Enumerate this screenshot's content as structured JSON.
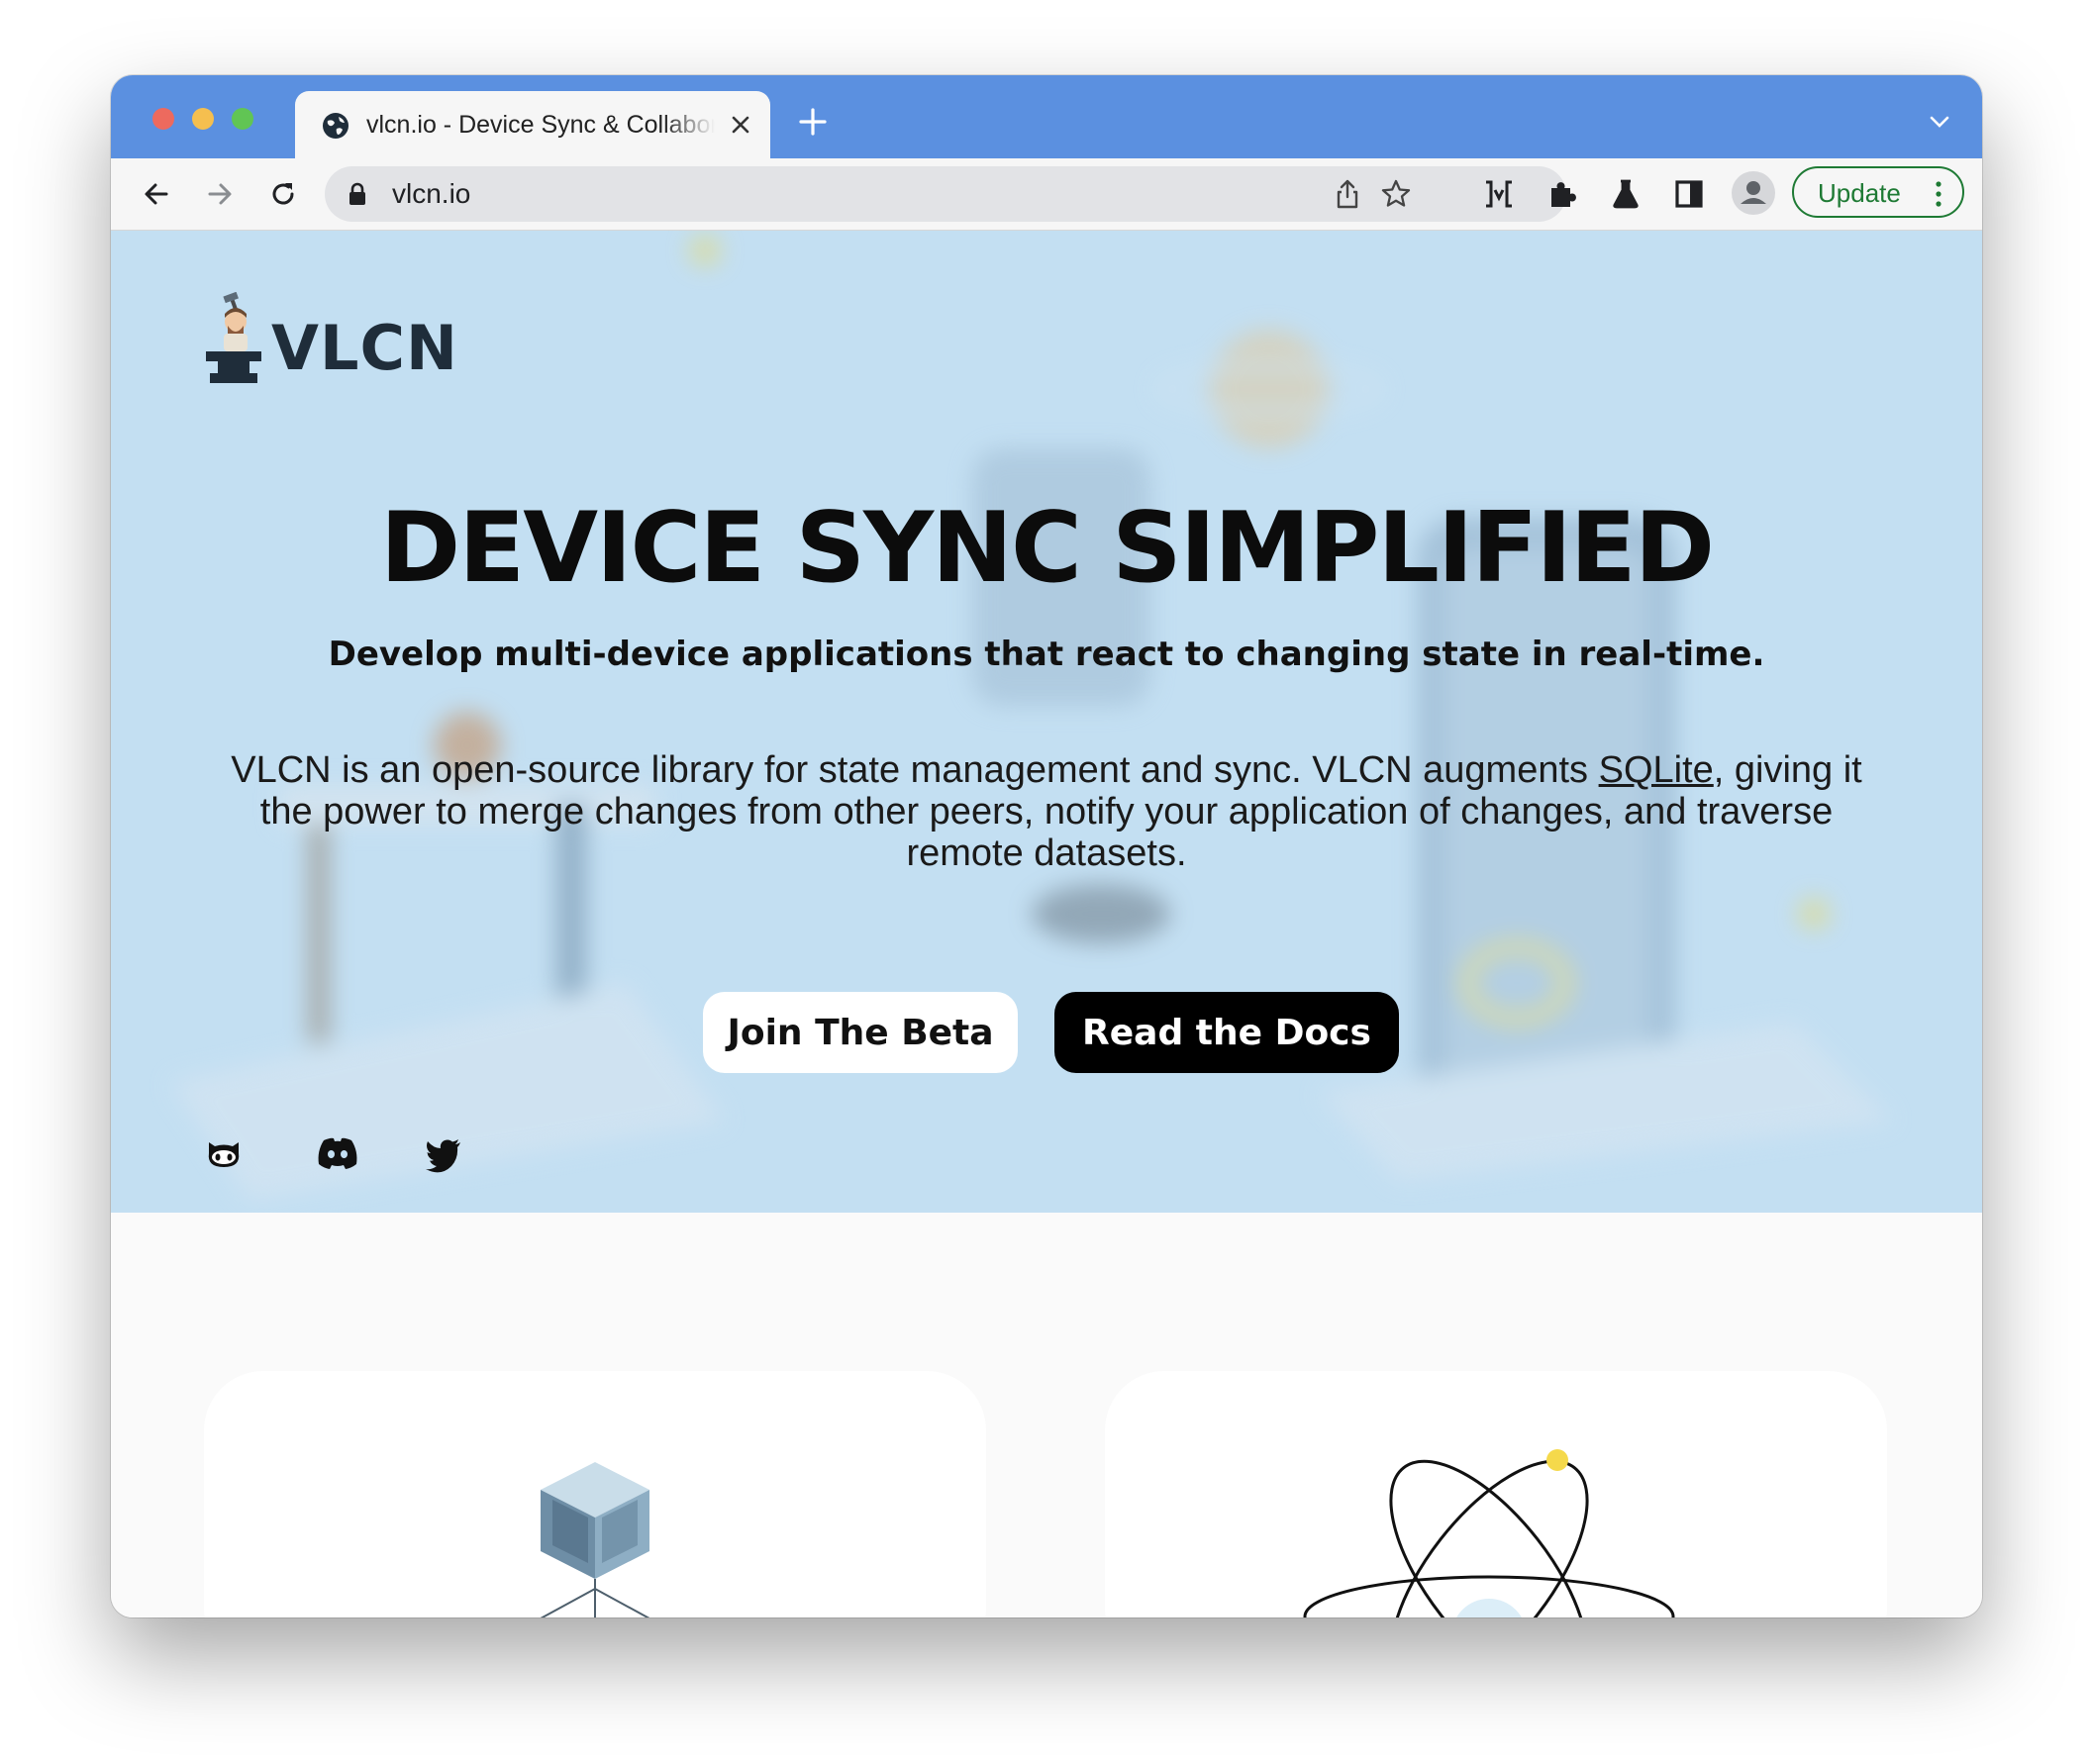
{
  "browser": {
    "tab": {
      "title": "vlcn.io - Device Sync & Collaboration"
    },
    "omnibox": {
      "url": "vlcn.io"
    },
    "update_button": {
      "label": "Update"
    },
    "colors": {
      "tabstrip": "#5b90e0",
      "update": "#1e7a34"
    }
  },
  "hero": {
    "logo_text": "VLCN",
    "title": "DEVICE SYNC SIMPLIFIED",
    "subtitle": "Develop multi-device applications that react to changing state in real-time.",
    "body_before_link": "VLCN is an open-source library for state management and sync. VLCN augments ",
    "body_link": "SQLite",
    "body_after_link": ", giving it the power to merge changes from other peers, notify your application of changes, and traverse remote datasets.",
    "buttons": {
      "beta": "Join The Beta",
      "docs": "Read the Docs"
    },
    "social": [
      "github-icon",
      "discord-icon",
      "twitter-icon"
    ],
    "colors": {
      "background": "#c3dff2"
    }
  },
  "features": {
    "cards": [
      {
        "icon": "cube-icon"
      },
      {
        "icon": "atom-icon"
      }
    ]
  }
}
